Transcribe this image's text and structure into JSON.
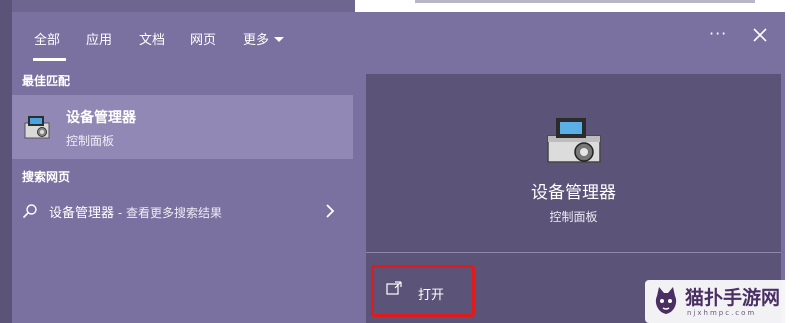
{
  "tabs": [
    {
      "label": "全部"
    },
    {
      "label": "应用"
    },
    {
      "label": "文档"
    },
    {
      "label": "网页"
    },
    {
      "label": "更多"
    }
  ],
  "header": {
    "more_options": "···"
  },
  "best_match": {
    "section_title": "最佳匹配",
    "title": "设备管理器",
    "subtitle": "控制面板",
    "icon": "device-manager-icon"
  },
  "web_search": {
    "section_title": "搜索网页",
    "query": "设备管理器",
    "suffix": " - 查看更多搜索结果"
  },
  "preview": {
    "title": "设备管理器",
    "subtitle": "控制面板",
    "open_label": "打开"
  },
  "watermark": {
    "text": "猫扑手游网",
    "url": "njxhmpc.com"
  },
  "colors": {
    "panel": "#7a71a0",
    "selected": "#9188b5",
    "preview": "#5b5478",
    "highlight_box": "#e11b1b"
  }
}
